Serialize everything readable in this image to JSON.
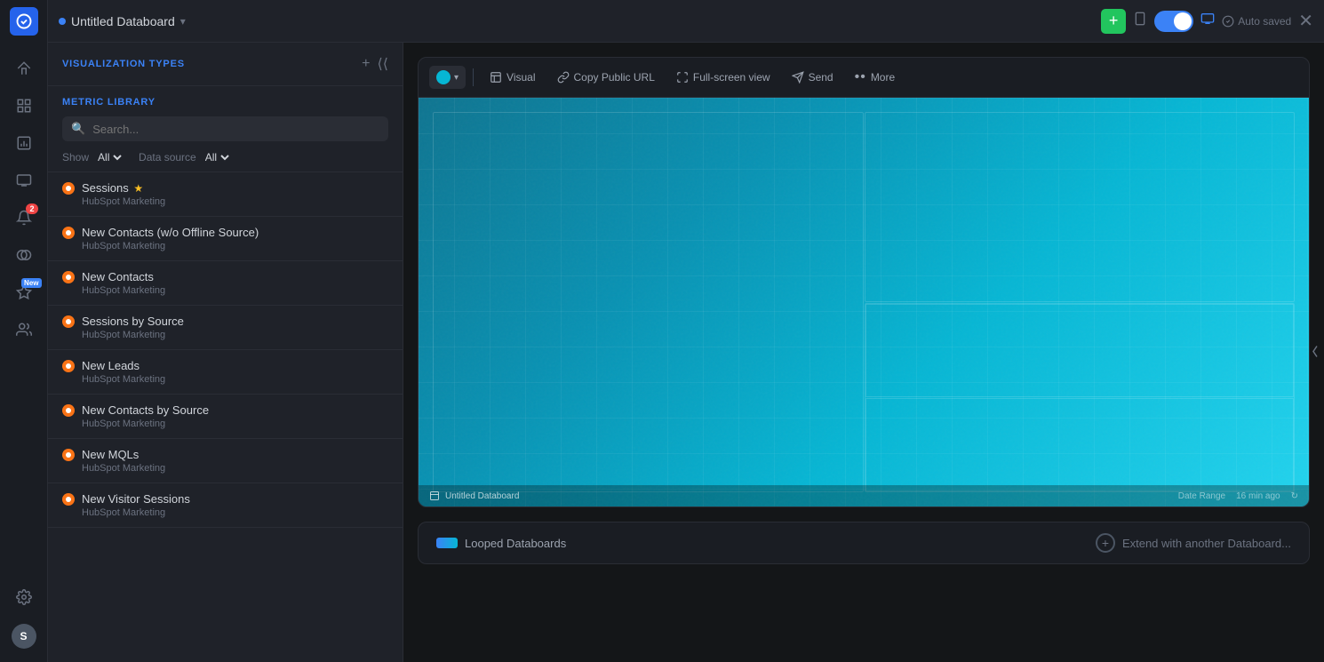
{
  "app": {
    "title": "Untitled Databoard",
    "status_dot_color": "#3b82f6",
    "auto_saved": "Auto saved"
  },
  "nav": {
    "logo": "G",
    "items": [
      {
        "name": "home",
        "icon": "home"
      },
      {
        "name": "dashboard",
        "icon": "grid"
      },
      {
        "name": "reports",
        "icon": "bar-chart"
      },
      {
        "name": "screen",
        "icon": "monitor"
      },
      {
        "name": "notifications",
        "icon": "bell",
        "badge": "2"
      },
      {
        "name": "connections",
        "icon": "link"
      },
      {
        "name": "new-feature",
        "icon": "star",
        "badge_new": "New"
      },
      {
        "name": "team",
        "icon": "users"
      }
    ],
    "settings": "settings",
    "avatar": "S"
  },
  "sidebar": {
    "visualization_types_label": "VISUALIZATION TYPES",
    "metric_library_label": "METRIC LIBRARY",
    "search_placeholder": "Search...",
    "show_label": "Show",
    "show_value": "All",
    "data_source_label": "Data source",
    "data_source_value": "All",
    "metrics": [
      {
        "name": "Sessions",
        "source": "HubSpot Marketing",
        "star": true
      },
      {
        "name": "New Contacts (w/o Offline Source)",
        "source": "HubSpot Marketing",
        "star": false
      },
      {
        "name": "New Contacts",
        "source": "HubSpot Marketing",
        "star": false
      },
      {
        "name": "Sessions by Source",
        "source": "HubSpot Marketing",
        "star": false
      },
      {
        "name": "New Leads",
        "source": "HubSpot Marketing",
        "star": false
      },
      {
        "name": "New Contacts by Source",
        "source": "HubSpot Marketing",
        "star": false
      },
      {
        "name": "New MQLs",
        "source": "HubSpot Marketing",
        "star": false
      },
      {
        "name": "New Visitor Sessions",
        "source": "HubSpot Marketing",
        "star": false
      }
    ]
  },
  "toolbar": {
    "color_label": "",
    "visual_label": "Visual",
    "copy_url_label": "Copy Public URL",
    "fullscreen_label": "Full-screen view",
    "send_label": "Send",
    "more_label": "More"
  },
  "preview": {
    "board_name": "Untitled Databoard",
    "date_range": "Date Range",
    "time_ago": "16 min ago"
  },
  "bottom_bar": {
    "loop_label": "Looped Databoards",
    "extend_label": "Extend with another Databoard..."
  }
}
